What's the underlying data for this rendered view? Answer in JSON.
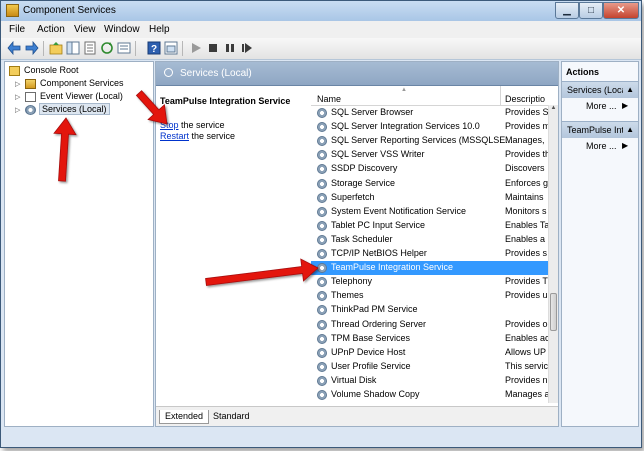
{
  "window": {
    "title": "Component Services"
  },
  "menu": {
    "items": [
      "File",
      "Action",
      "View",
      "Window",
      "Help"
    ]
  },
  "tree": {
    "root": "Console Root",
    "items": [
      "Component Services",
      "Event Viewer (Local)",
      "Services (Local)"
    ]
  },
  "center": {
    "header": "Services (Local)",
    "selected_service": "TeamPulse Integration Service",
    "stop_link": "Stop",
    "stop_rest": " the service",
    "restart_link": "Restart",
    "restart_rest": " the service"
  },
  "list": {
    "columns": {
      "name": "Name",
      "description": "Descriptio"
    },
    "rows": [
      {
        "name": "SQL Server Browser",
        "desc": "Provides S"
      },
      {
        "name": "SQL Server Integration Services 10.0",
        "desc": "Provides m"
      },
      {
        "name": "SQL Server Reporting Services (MSSQLSE...",
        "desc": "Manages, "
      },
      {
        "name": "SQL Server VSS Writer",
        "desc": "Provides th"
      },
      {
        "name": "SSDP Discovery",
        "desc": "Discovers"
      },
      {
        "name": "Storage Service",
        "desc": "Enforces g"
      },
      {
        "name": "Superfetch",
        "desc": "Maintains"
      },
      {
        "name": "System Event Notification Service",
        "desc": "Monitors s"
      },
      {
        "name": "Tablet PC Input Service",
        "desc": "Enables Ta"
      },
      {
        "name": "Task Scheduler",
        "desc": "Enables a"
      },
      {
        "name": "TCP/IP NetBIOS Helper",
        "desc": "Provides s"
      },
      {
        "name": "TeamPulse Integration Service",
        "desc": ""
      },
      {
        "name": "Telephony",
        "desc": "Provides T"
      },
      {
        "name": "Themes",
        "desc": "Provides u"
      },
      {
        "name": "ThinkPad PM Service",
        "desc": ""
      },
      {
        "name": "Thread Ordering Server",
        "desc": "Provides o"
      },
      {
        "name": "TPM Base Services",
        "desc": "Enables ac"
      },
      {
        "name": "UPnP Device Host",
        "desc": "Allows UP"
      },
      {
        "name": "User Profile Service",
        "desc": "This servic"
      },
      {
        "name": "Virtual Disk",
        "desc": "Provides n"
      },
      {
        "name": "Volume Shadow Copy",
        "desc": "Manages a"
      }
    ]
  },
  "tabs": [
    "Extended",
    "Standard"
  ],
  "actions": {
    "title": "Actions",
    "sections": [
      {
        "label": "Services (Local)",
        "more": "More ..."
      },
      {
        "label": "TeamPulse Integration Service",
        "more": "More ..."
      }
    ]
  },
  "colors": {
    "annotation_arrow": "#e3130f",
    "selection": "#3399ff",
    "header_blue": "#98aec8"
  }
}
